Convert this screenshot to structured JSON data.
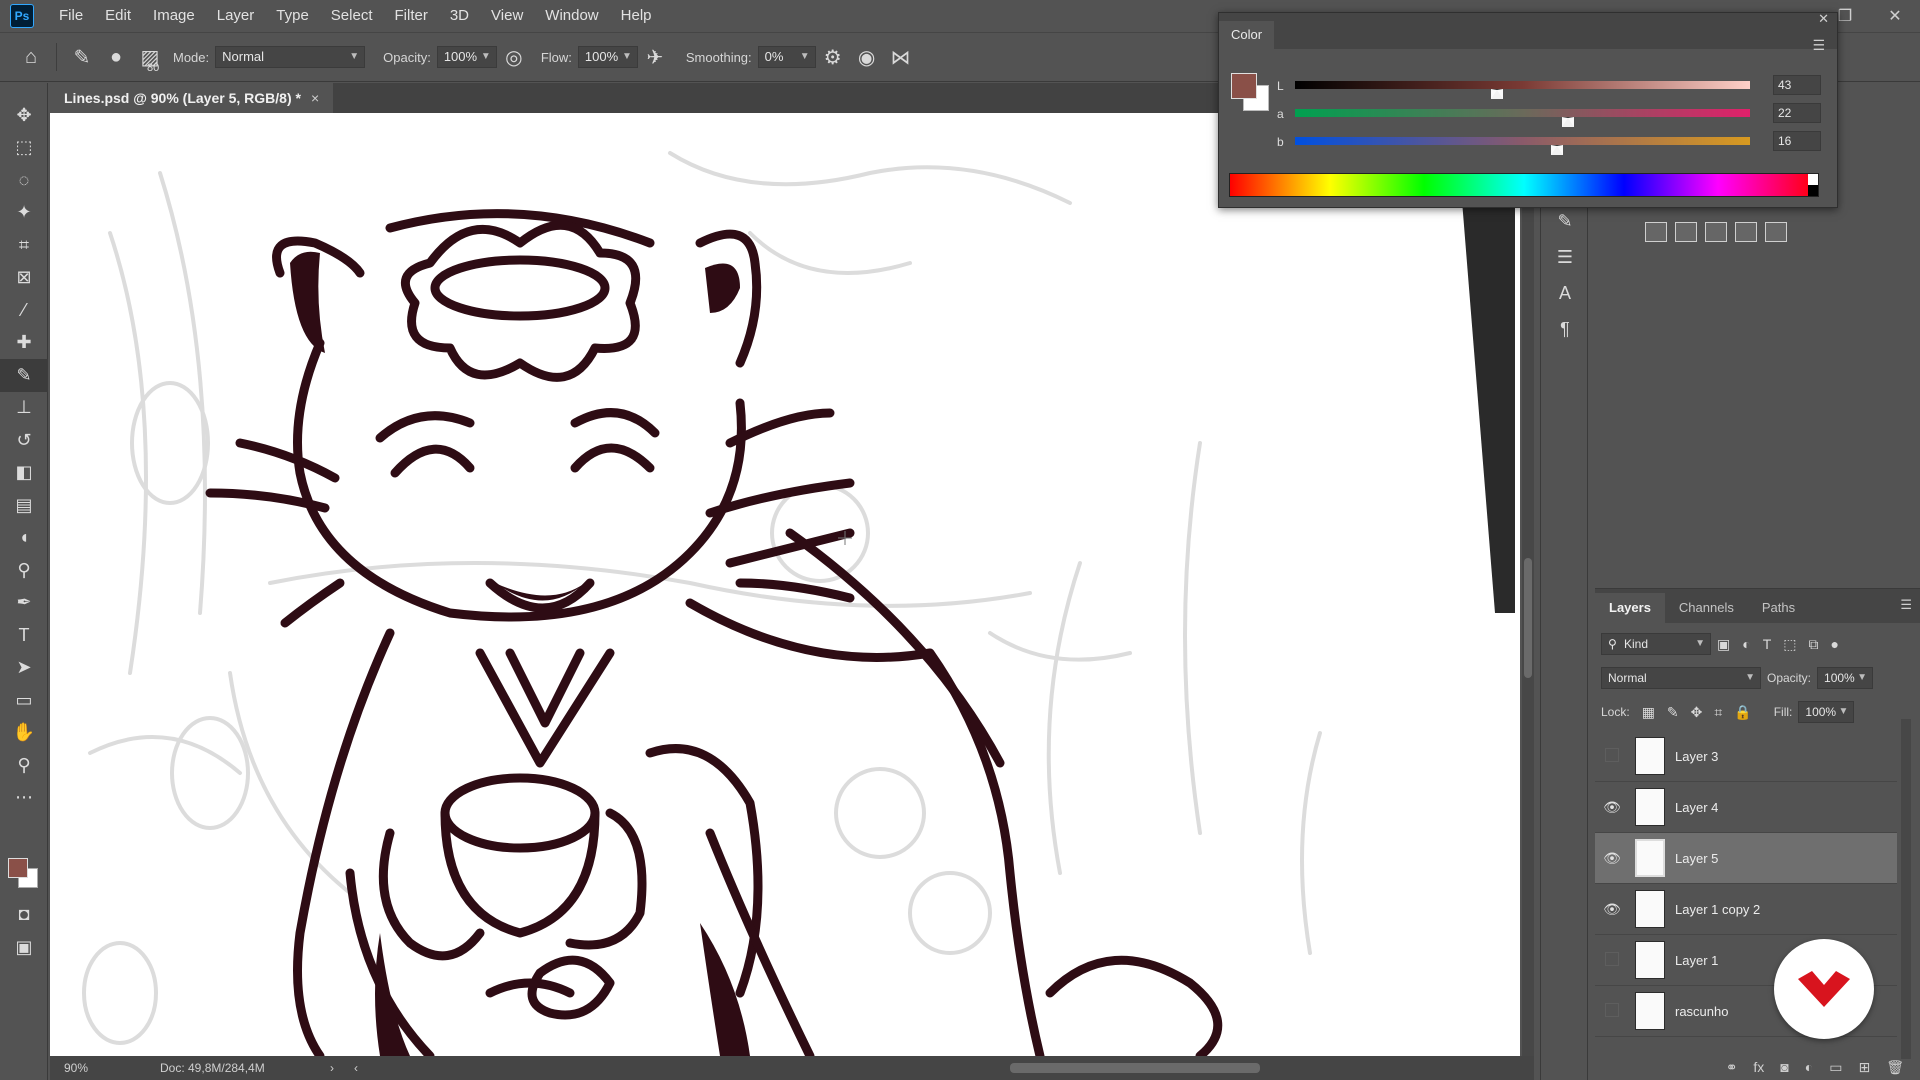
{
  "app": {
    "logo": "Ps"
  },
  "menu": [
    "File",
    "Edit",
    "Image",
    "Layer",
    "Type",
    "Select",
    "Filter",
    "3D",
    "View",
    "Window",
    "Help"
  ],
  "options": {
    "brush_size": "80",
    "mode_label": "Mode:",
    "mode_value": "Normal",
    "opacity_label": "Opacity:",
    "opacity_value": "100%",
    "flow_label": "Flow:",
    "flow_value": "100%",
    "smoothing_label": "Smoothing:",
    "smoothing_value": "0%"
  },
  "document": {
    "tab_title": "Lines.psd @ 90% (Layer 5, RGB/8) *",
    "close": "×"
  },
  "status": {
    "zoom": "90%",
    "doc": "Doc: 49,8M/284,4M"
  },
  "color_panel": {
    "title": "Color",
    "foreground_color": "#8a5048",
    "background_color": "#ffffff",
    "sliders": [
      {
        "label": "L",
        "value": "43",
        "fraction": 0.43
      },
      {
        "label": "a",
        "value": "22",
        "fraction": 0.586
      },
      {
        "label": "b",
        "value": "16",
        "fraction": 0.563
      }
    ]
  },
  "layers_panel": {
    "tabs": [
      "Layers",
      "Channels",
      "Paths"
    ],
    "filter_label": "Kind",
    "blend_mode": "Normal",
    "opacity_label": "Opacity:",
    "opacity_value": "100%",
    "lock_label": "Lock:",
    "fill_label": "Fill:",
    "fill_value": "100%",
    "layers": [
      {
        "name": "Layer 3",
        "visible": false,
        "selected": false
      },
      {
        "name": "Layer 4",
        "visible": true,
        "selected": false
      },
      {
        "name": "Layer 5",
        "visible": true,
        "selected": true
      },
      {
        "name": "Layer 1 copy 2",
        "visible": true,
        "selected": false
      },
      {
        "name": "Layer 1",
        "visible": false,
        "selected": false
      },
      {
        "name": "rascunho",
        "visible": false,
        "selected": false
      }
    ]
  },
  "colors": {
    "ink": "#2e0c14",
    "accent_badge": "#d8141e",
    "ps_blue": "#31a8ff"
  }
}
